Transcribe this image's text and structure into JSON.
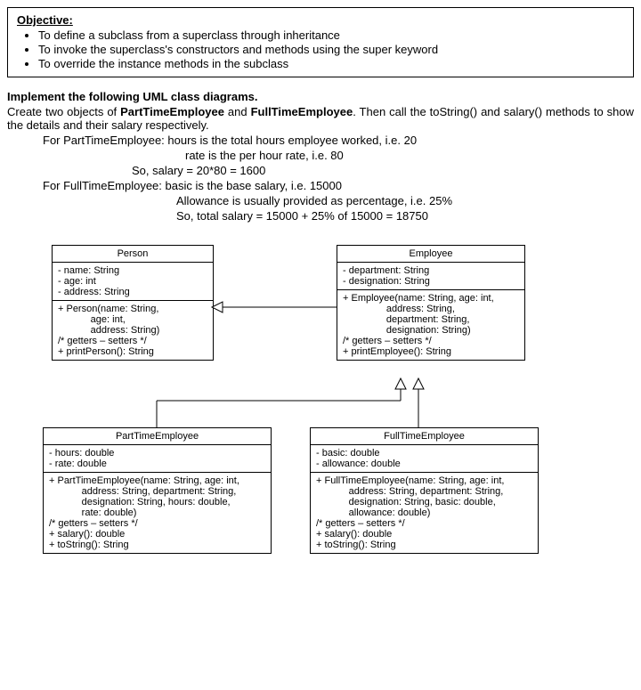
{
  "objective": {
    "title": "Objective:",
    "bullets": [
      "To define a subclass from a superclass through inheritance",
      "To invoke the superclass's constructors and methods using the super keyword",
      "To override the instance methods in the subclass"
    ]
  },
  "instructions": {
    "heading": "Implement the following UML class diagrams.",
    "line1a": "Create two objects of ",
    "line1b": "PartTimeEmployee",
    "line1c": " and ",
    "line1d": "FullTimeEmployee",
    "line1e": ". Then call the toString() and salary() methods to show the details and their salary respectively.",
    "line2": "For PartTimeEmployee: hours is the total hours employee worked, i.e. 20",
    "line3": "rate is the per hour rate, i.e. 80",
    "line4": "So, salary = 20*80 = 1600",
    "line5": "For FullTimeEmployee: basic is the base salary, i.e. 15000",
    "line6": "Allowance is usually provided as percentage, i.e. 25%",
    "line7": "So, total salary = 15000 + 25% of 15000 = 18750"
  },
  "uml": {
    "person": {
      "title": "Person",
      "attrs": "- name: String\n- age: int\n- address: String",
      "methods": "+ Person(name: String,\n            age: int,\n            address: String)\n/* getters – setters */\n+ printPerson(): String"
    },
    "employee": {
      "title": "Employee",
      "attrs": "- department: String\n- designation: String",
      "methods": "+ Employee(name: String, age: int,\n                address: String,\n                department: String,\n                designation: String)\n/* getters – setters */\n+ printEmployee(): String"
    },
    "parttime": {
      "title": "PartTimeEmployee",
      "attrs": "- hours: double\n- rate: double",
      "methods": "+ PartTimeEmployee(name: String, age: int,\n            address: String, department: String,\n            designation: String, hours: double,\n            rate: double)\n/* getters – setters */\n+ salary(): double\n+ toString(): String"
    },
    "fulltime": {
      "title": "FullTimeEmployee",
      "attrs": "- basic: double\n- allowance: double",
      "methods": "+ FullTimeEmployee(name: String, age: int,\n            address: String, department: String,\n            designation: String, basic: double,\n            allowance: double)\n/* getters – setters */\n+ salary(): double\n+ toString(): String"
    }
  }
}
